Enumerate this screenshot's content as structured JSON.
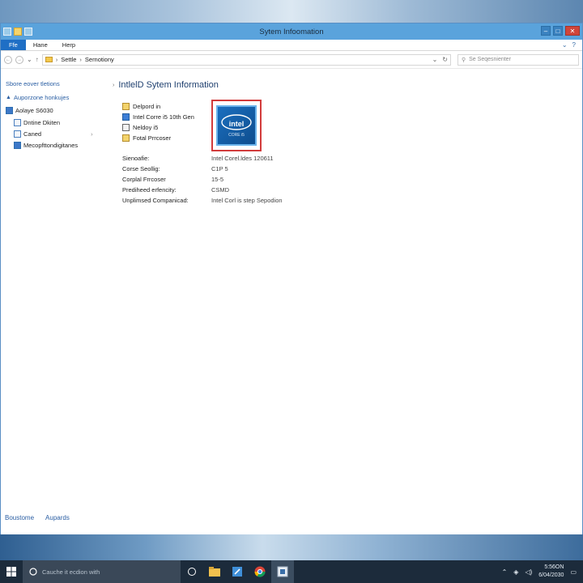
{
  "window": {
    "title": "Sytem Infoomation"
  },
  "ribbon": {
    "tabs": [
      {
        "label": "Ffe",
        "active": true
      },
      {
        "label": "Hane",
        "active": false
      },
      {
        "label": "Herp",
        "active": false
      }
    ]
  },
  "address": {
    "crumbs": [
      "Settle",
      "Sernotiony"
    ],
    "search_placeholder": "Se Seqesnienter"
  },
  "nav_pane": {
    "items": [
      {
        "label": "Sbore eover tletions",
        "type": "link"
      },
      {
        "label": "Auporzone honkujes",
        "type": "link"
      },
      {
        "label": "Aolaye S6030",
        "type": "item"
      },
      {
        "label": "Dntine Dkiten",
        "type": "item"
      },
      {
        "label": "Caned",
        "type": "item"
      },
      {
        "label": "Mecopfttondigitanes",
        "type": "item"
      }
    ]
  },
  "content": {
    "heading": "IntlelD Sytem Information",
    "properties": [
      "Delpord in",
      "Intel Corre i5 10th Gen",
      "Neldoy i5",
      "Fotal Prrcoser"
    ],
    "specs": [
      {
        "key": "Sienoafie:",
        "value": "Intel Corel.ldes 120611"
      },
      {
        "key": "Corse Seollig:",
        "value": "C1P 5"
      },
      {
        "key": "Corplal Frrcoser",
        "value": "15-5"
      },
      {
        "key": "Prediheed erfencity:",
        "value": "CSMD"
      },
      {
        "key": "Unplimsed Companicad:",
        "value": "Intel Corl is step Sepodion"
      }
    ],
    "logo": {
      "brand": "intel",
      "sub": "CORE i5"
    }
  },
  "statusbar": {
    "items": [
      "Boustome",
      "Aupards"
    ]
  },
  "taskbar": {
    "search_placeholder": "Cauche it ecdion with",
    "clock_time": "5:56ON",
    "clock_date": "6/04/2030"
  },
  "colors": {
    "titlebar": "#5aa3dc",
    "file_tab": "#1f6fc5",
    "taskbar": "#1c2b3b",
    "highlight": "#d23c3c",
    "link": "#2a5ea3"
  }
}
